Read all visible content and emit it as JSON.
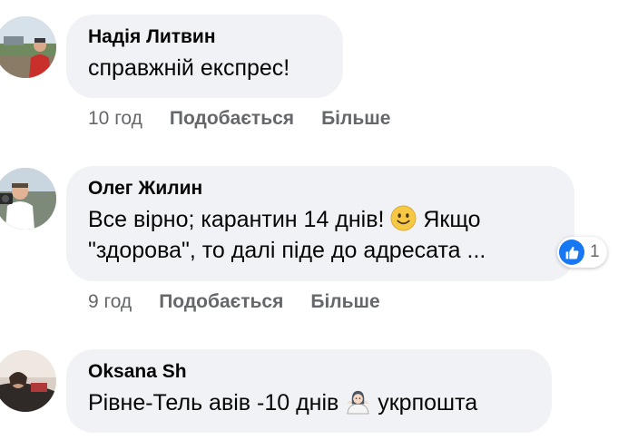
{
  "comments": [
    {
      "author": "Надія Литвин",
      "text": "справжній експрес!",
      "time": "10 год",
      "like_label": "Подобається",
      "more_label": "Більше"
    },
    {
      "author": "Олег Жилин",
      "text_line1_a": "Все вірно; карантин 14 днів!",
      "text_line1_b": "Якщо",
      "text_line2": "\"здорова\", то далі піде до адресата ...",
      "time": "9 год",
      "like_label": "Подобається",
      "more_label": "Більше",
      "reaction_count": "1",
      "reaction_icon": "thumbs-up-icon"
    },
    {
      "author": "Oksana Sh",
      "text_a": "Рівне-Тель авів -10 днів",
      "text_b": "укрпошта"
    }
  ],
  "colors": {
    "bubble": "#f0f2f5",
    "meta": "#65676b",
    "text": "#050505",
    "like_blue": "#1877f2"
  }
}
